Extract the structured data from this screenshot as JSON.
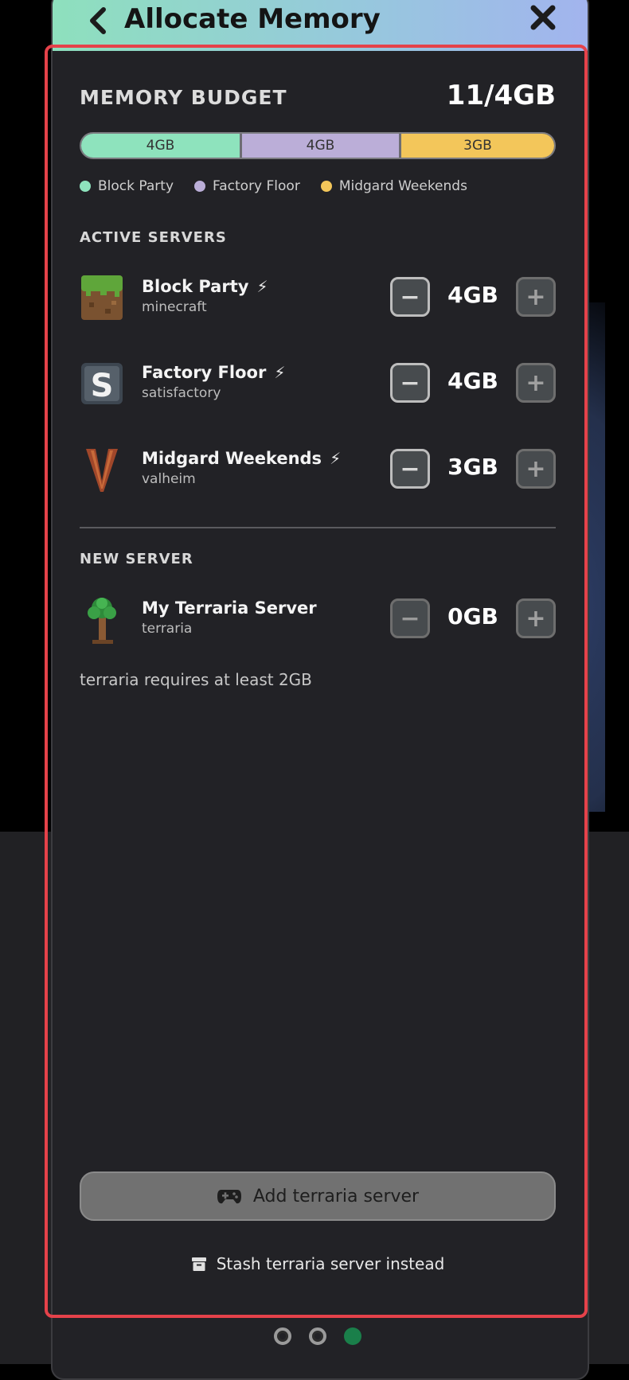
{
  "header": {
    "title": "Allocate Memory"
  },
  "budget": {
    "label": "MEMORY BUDGET",
    "total": "11/4GB",
    "segments": [
      {
        "label": "4GB",
        "server": "Block Party",
        "color": "#8ee3bd"
      },
      {
        "label": "4GB",
        "server": "Factory Floor",
        "color": "#bbaed8"
      },
      {
        "label": "3GB",
        "server": "Midgard Weekends",
        "color": "#f3c65a"
      }
    ]
  },
  "active": {
    "title": "ACTIVE SERVERS",
    "servers": [
      {
        "name": "Block Party",
        "game": "minecraft",
        "memory": "4GB"
      },
      {
        "name": "Factory Floor",
        "game": "satisfactory",
        "memory": "4GB"
      },
      {
        "name": "Midgard Weekends",
        "game": "valheim",
        "memory": "3GB"
      }
    ]
  },
  "new_server": {
    "title": "NEW SERVER",
    "name": "My Terraria Server",
    "game": "terraria",
    "memory": "0GB",
    "hint": "terraria requires at least 2GB"
  },
  "actions": {
    "add_label": "Add terraria server",
    "stash_label": "Stash terraria server instead"
  },
  "icons": {
    "back": "chevron-left-icon",
    "close": "close-icon",
    "bolt": "lightning-icon",
    "minus": "minus-icon",
    "plus": "plus-icon",
    "gamepad": "gamepad-icon",
    "archive": "archive-icon"
  },
  "pager": {
    "count": 3,
    "active_index": 2
  }
}
